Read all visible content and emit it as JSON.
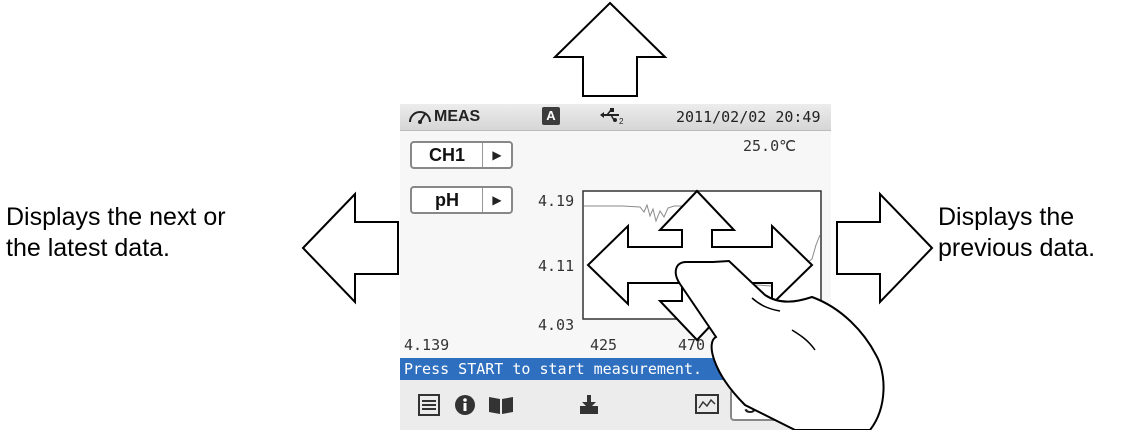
{
  "captions": {
    "left_line1": "Displays the next or",
    "left_line2": "the latest data.",
    "right_line1": "Displays the",
    "right_line2": "previous data."
  },
  "device": {
    "status": {
      "mode": "MEAS",
      "mode_icon": "gauge-icon",
      "a_badge": "A",
      "usb_icon": "usb-icon",
      "datetime": "2011/02/02 20:49"
    },
    "temperature": "25.0℃",
    "channel_selector": {
      "label": "CH1",
      "arrow_icon": "play-icon"
    },
    "param_selector": {
      "label": "pH",
      "arrow_icon": "play-icon"
    },
    "graph": {
      "y_top": "4.19",
      "y_mid": "4.11",
      "y_bottom": "4.03",
      "x_first": "425",
      "x_second": "470"
    },
    "current_value": "4.139",
    "message": "Press START to start measurement.",
    "bottom_bar": {
      "icons": [
        "list-icon",
        "info-icon",
        "book-icon",
        "download-icon",
        "graph-icon"
      ],
      "start_label": "START"
    }
  },
  "gesture": {
    "icon": "hand-icon",
    "arrows": [
      "up",
      "down",
      "left",
      "right"
    ]
  },
  "chart_data": {
    "type": "line",
    "yticks": [
      "4.19",
      "4.11",
      "4.03"
    ],
    "xticks": [
      "425",
      "470"
    ],
    "ylim": [
      4.03,
      4.19
    ],
    "grid": false
  }
}
